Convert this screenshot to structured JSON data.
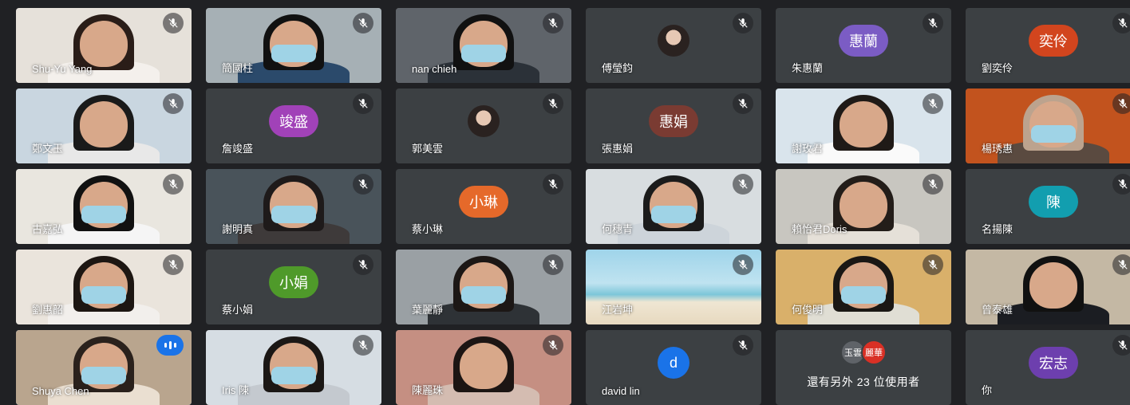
{
  "participants": [
    {
      "name": "Shu-Yu Yang",
      "type": "video",
      "bg": "#e6e1da",
      "hair": "#2a1d18",
      "shirt": "#f4f0ec",
      "mask": false
    },
    {
      "name": "簡國柱",
      "type": "video",
      "bg": "#a6b0b5",
      "hair": "#111",
      "shirt": "#2b4a6b",
      "mask": true
    },
    {
      "name": "nan chieh",
      "type": "video",
      "bg": "#5f646a",
      "hair": "#111",
      "shirt": "#2b3138",
      "mask": true
    },
    {
      "name": "傅瑩鈞",
      "type": "photo",
      "bg": "#3c4043"
    },
    {
      "name": "朱惠蘭",
      "type": "avatar",
      "initials": "惠蘭",
      "color": "#7b5cc4"
    },
    {
      "name": "劉奕伶",
      "type": "avatar",
      "initials": "奕伶",
      "color": "#d2451e"
    },
    {
      "name": "鄭文玉",
      "type": "video",
      "bg": "#c9d6e0",
      "hair": "#1a1a1a",
      "shirt": "#e8e8e8",
      "mask": false
    },
    {
      "name": "詹竣盛",
      "type": "avatar",
      "initials": "竣盛",
      "color": "#a142b8"
    },
    {
      "name": "郭美雲",
      "type": "photo",
      "bg": "#3c4043"
    },
    {
      "name": "張惠娟",
      "type": "avatar",
      "initials": "惠娟",
      "color": "#7a3b32"
    },
    {
      "name": "謝玫君",
      "type": "video",
      "bg": "#d9e4ec",
      "hair": "#1f1a17",
      "shirt": "#fafafa",
      "mask": false
    },
    {
      "name": "楊琇惠",
      "type": "video",
      "bg": "#c2531e",
      "hair": "#bca38e",
      "shirt": "#5a4a40",
      "mask": true
    },
    {
      "name": "古嘉弘",
      "type": "video",
      "bg": "#e9e6df",
      "hair": "#111",
      "shirt": "#f5f5f5",
      "mask": true
    },
    {
      "name": "謝明真",
      "type": "video",
      "bg": "#49535a",
      "hair": "#1e1a1a",
      "shirt": "#3e3a3a",
      "mask": true
    },
    {
      "name": "蔡小琳",
      "type": "avatar",
      "initials": "小琳",
      "color": "#e5692a"
    },
    {
      "name": "何穗青",
      "type": "video",
      "bg": "#d8dde0",
      "hair": "#1b1b1b",
      "shirt": "#cdd4da",
      "mask": true
    },
    {
      "name": "賴怡君Doris",
      "type": "video",
      "bg": "#c8c6c0",
      "hair": "#231d19",
      "shirt": "#e5e0d8",
      "mask": false
    },
    {
      "name": "名揚陳",
      "type": "avatar",
      "initials": "陳",
      "color": "#129eaf"
    },
    {
      "name": "劉惠韶",
      "type": "video",
      "bg": "#eae4dc",
      "hair": "#1d1612",
      "shirt": "#f2efec",
      "mask": true
    },
    {
      "name": "蔡小娟",
      "type": "avatar",
      "initials": "小娟",
      "color": "#4f9a2a"
    },
    {
      "name": "葉麗靜",
      "type": "video",
      "bg": "#9aa0a4",
      "hair": "#1c1715",
      "shirt": "#2e3236",
      "mask": true
    },
    {
      "name": "江岩坤",
      "type": "video",
      "bg": "#9fd4ea",
      "hair": "none",
      "shirt": "#e8dcc8",
      "mask": false
    },
    {
      "name": "何俊明",
      "type": "video",
      "bg": "#d9b06a",
      "hair": "#1a1714",
      "shirt": "#e0ded4",
      "mask": true
    },
    {
      "name": "曾泰雄",
      "type": "video",
      "bg": "#c4b8a4",
      "hair": "#111",
      "shirt": "#1b1d22",
      "mask": false
    },
    {
      "name": "Shuya Chen",
      "type": "video",
      "bg": "#b9a58e",
      "hair": "#2a211c",
      "shirt": "#eadfd1",
      "mask": true,
      "speaking": true
    },
    {
      "name": "Iris 陳",
      "type": "video",
      "bg": "#d6dde3",
      "hair": "#1b1715",
      "shirt": "#c4c9cf",
      "mask": true
    },
    {
      "name": "陳麗珠",
      "type": "video",
      "bg": "#c58f82",
      "hair": "#1c1513",
      "shirt": "#d4bcb1",
      "mask": false
    },
    {
      "name": "david lin",
      "type": "avatar",
      "initials": "d",
      "color": "#1a73e8",
      "round": true
    },
    {
      "name": "",
      "type": "overflow",
      "text": "還有另外 23 位使用者",
      "avatars": [
        {
          "t": "玉雲",
          "c": "#5f6368"
        },
        {
          "t": "麗華",
          "c": "#d93025"
        }
      ]
    },
    {
      "name": "你",
      "type": "avatar",
      "initials": "宏志",
      "color": "#6d3fae"
    }
  ],
  "icons": {
    "muted": "mic-off-icon",
    "speaking": "audio-level-icon"
  },
  "colors": {
    "background": "#202124",
    "tile": "#3c4043",
    "active_border": "#8ab4f8"
  }
}
